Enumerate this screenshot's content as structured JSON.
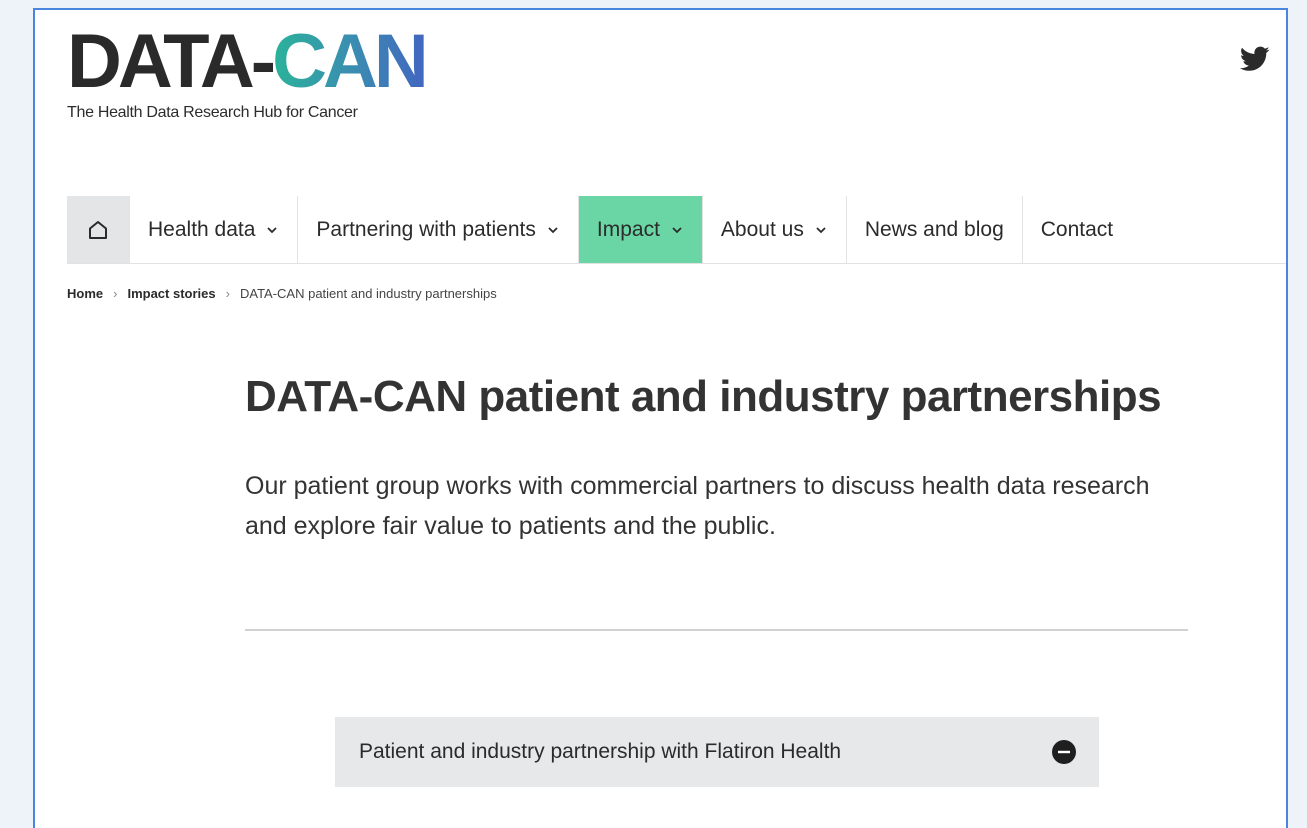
{
  "logo": {
    "part_data": "DATA",
    "part_dash": "-",
    "part_can": "CAN",
    "tagline": "The Health Data Research Hub for Cancer"
  },
  "header": {
    "social_icon": "twitter-icon"
  },
  "nav": {
    "home_icon": "home-icon",
    "items": [
      {
        "label": "Health data",
        "has_dropdown": true
      },
      {
        "label": "Partnering with patients",
        "has_dropdown": true
      },
      {
        "label": "Impact",
        "has_dropdown": true,
        "active": true
      },
      {
        "label": "About us",
        "has_dropdown": true
      },
      {
        "label": "News and blog",
        "has_dropdown": false
      },
      {
        "label": "Contact",
        "has_dropdown": false
      }
    ],
    "active_color": "#6ad6a6"
  },
  "breadcrumb": {
    "items": [
      "Home",
      "Impact stories",
      "DATA-CAN patient and industry partnerships"
    ]
  },
  "main": {
    "title": "DATA-CAN patient and industry partnerships",
    "intro": "Our patient group works with commercial partners to discuss health data research and explore fair value to patients and the public.",
    "accordion": {
      "label": "Patient and industry partnership with Flatiron Health",
      "state_icon": "minus-circle-icon"
    }
  },
  "colors": {
    "frame_border": "#4a86e0",
    "logo_gradient_start": "#2ab39a",
    "logo_gradient_end": "#4266c0"
  }
}
